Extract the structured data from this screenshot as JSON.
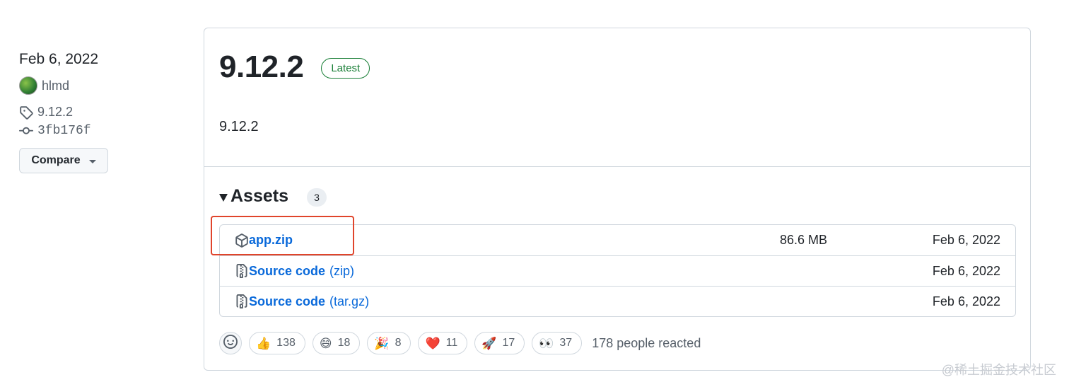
{
  "sidebar": {
    "date": "Feb 6, 2022",
    "author": "hlmd",
    "tag": "9.12.2",
    "commit": "3fb176f",
    "compare_label": "Compare"
  },
  "release": {
    "title": "9.12.2",
    "badge": "Latest",
    "body": "9.12.2"
  },
  "assets": {
    "title": "Assets",
    "count": "3",
    "items": [
      {
        "name": "app.zip",
        "suffix": "",
        "size": "86.6 MB",
        "date": "Feb 6, 2022",
        "icon": "package-icon"
      },
      {
        "name": "Source code",
        "suffix": "(zip)",
        "size": "",
        "date": "Feb 6, 2022",
        "icon": "file-zip-icon"
      },
      {
        "name": "Source code",
        "suffix": "(tar.gz)",
        "size": "",
        "date": "Feb 6, 2022",
        "icon": "file-zip-icon"
      }
    ]
  },
  "reactions": {
    "items": [
      {
        "emoji": "👍",
        "count": "138"
      },
      {
        "emoji": "😄",
        "count": "18"
      },
      {
        "emoji": "🎉",
        "count": "8"
      },
      {
        "emoji": "❤️",
        "count": "11"
      },
      {
        "emoji": "🚀",
        "count": "17"
      },
      {
        "emoji": "👀",
        "count": "37"
      }
    ],
    "summary": "178 people reacted"
  },
  "watermark": "@稀土掘金技术社区",
  "colors": {
    "link": "#0969da",
    "latest_badge": "#1a7f37",
    "highlight_box": "#e0442b",
    "border": "#d0d7de"
  }
}
